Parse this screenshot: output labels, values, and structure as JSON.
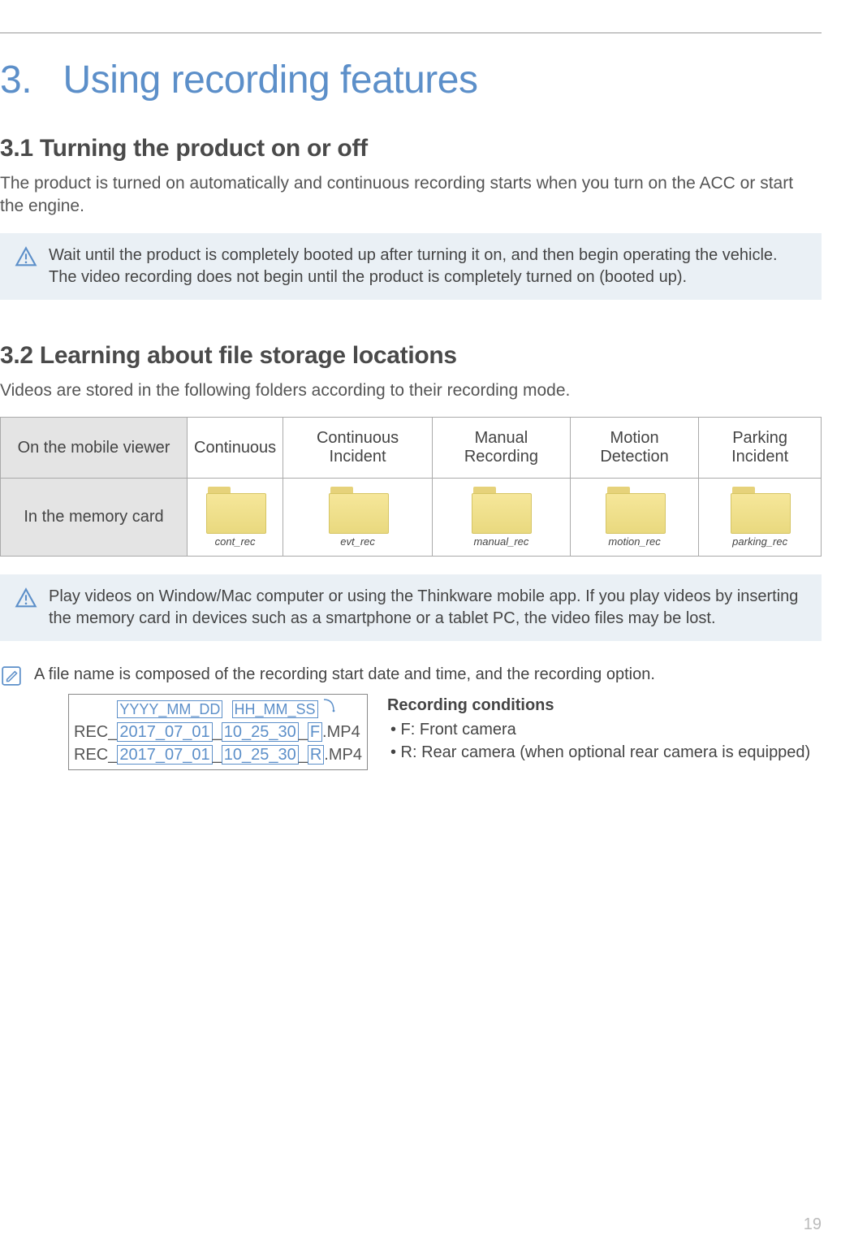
{
  "chapter": {
    "number": "3.",
    "title": "Using recording features"
  },
  "section31": {
    "heading": "3.1   Turning the product on or off",
    "body": "The product is turned on automatically and continuous recording starts when you turn on the ACC or start the engine.",
    "warning": "Wait until the product is completely booted up after turning it on, and then begin operating the vehicle. The video recording does not begin until the product is completely turned on (booted up)."
  },
  "section32": {
    "heading": "3.2   Learning about file storage locations",
    "body": "Videos are stored in the following folders according to their recording mode."
  },
  "table": {
    "row1_header": "On the mobile viewer",
    "row2_header": "In the memory card",
    "cols": [
      {
        "viewer": "Continuous",
        "folder": "cont_rec"
      },
      {
        "viewer": "Continuous Incident",
        "folder": "evt_rec"
      },
      {
        "viewer": "Manual Recording",
        "folder": "manual_rec"
      },
      {
        "viewer": "Motion Detection",
        "folder": "motion_rec"
      },
      {
        "viewer": "Parking Incident",
        "folder": "parking_rec"
      }
    ]
  },
  "warning2": "Play videos on Window/Mac computer or using the Thinkware mobile app. If you play videos by inserting the memory card in devices such as a smartphone or a tablet PC, the video files may be lost.",
  "note": {
    "intro": "A file name is composed of the recording start date and time, and the recording option.",
    "labels": {
      "date": "YYYY_MM_DD",
      "time": "HH_MM_SS"
    },
    "file1": {
      "prefix": "REC_",
      "date": "2017_07_01",
      "sep1": "_",
      "time": "10_25_30",
      "sep2": "_",
      "opt": "F",
      "ext": ".MP4"
    },
    "file2": {
      "prefix": "REC_",
      "date": "2017_07_01",
      "sep1": "_",
      "time": "10_25_30",
      "sep2": "_",
      "opt": "R",
      "ext": ".MP4"
    },
    "cond_title": "Recording conditions",
    "cond1": "• F: Front camera",
    "cond2": "• R: Rear camera (when optional rear camera is equipped)"
  },
  "page": "19"
}
